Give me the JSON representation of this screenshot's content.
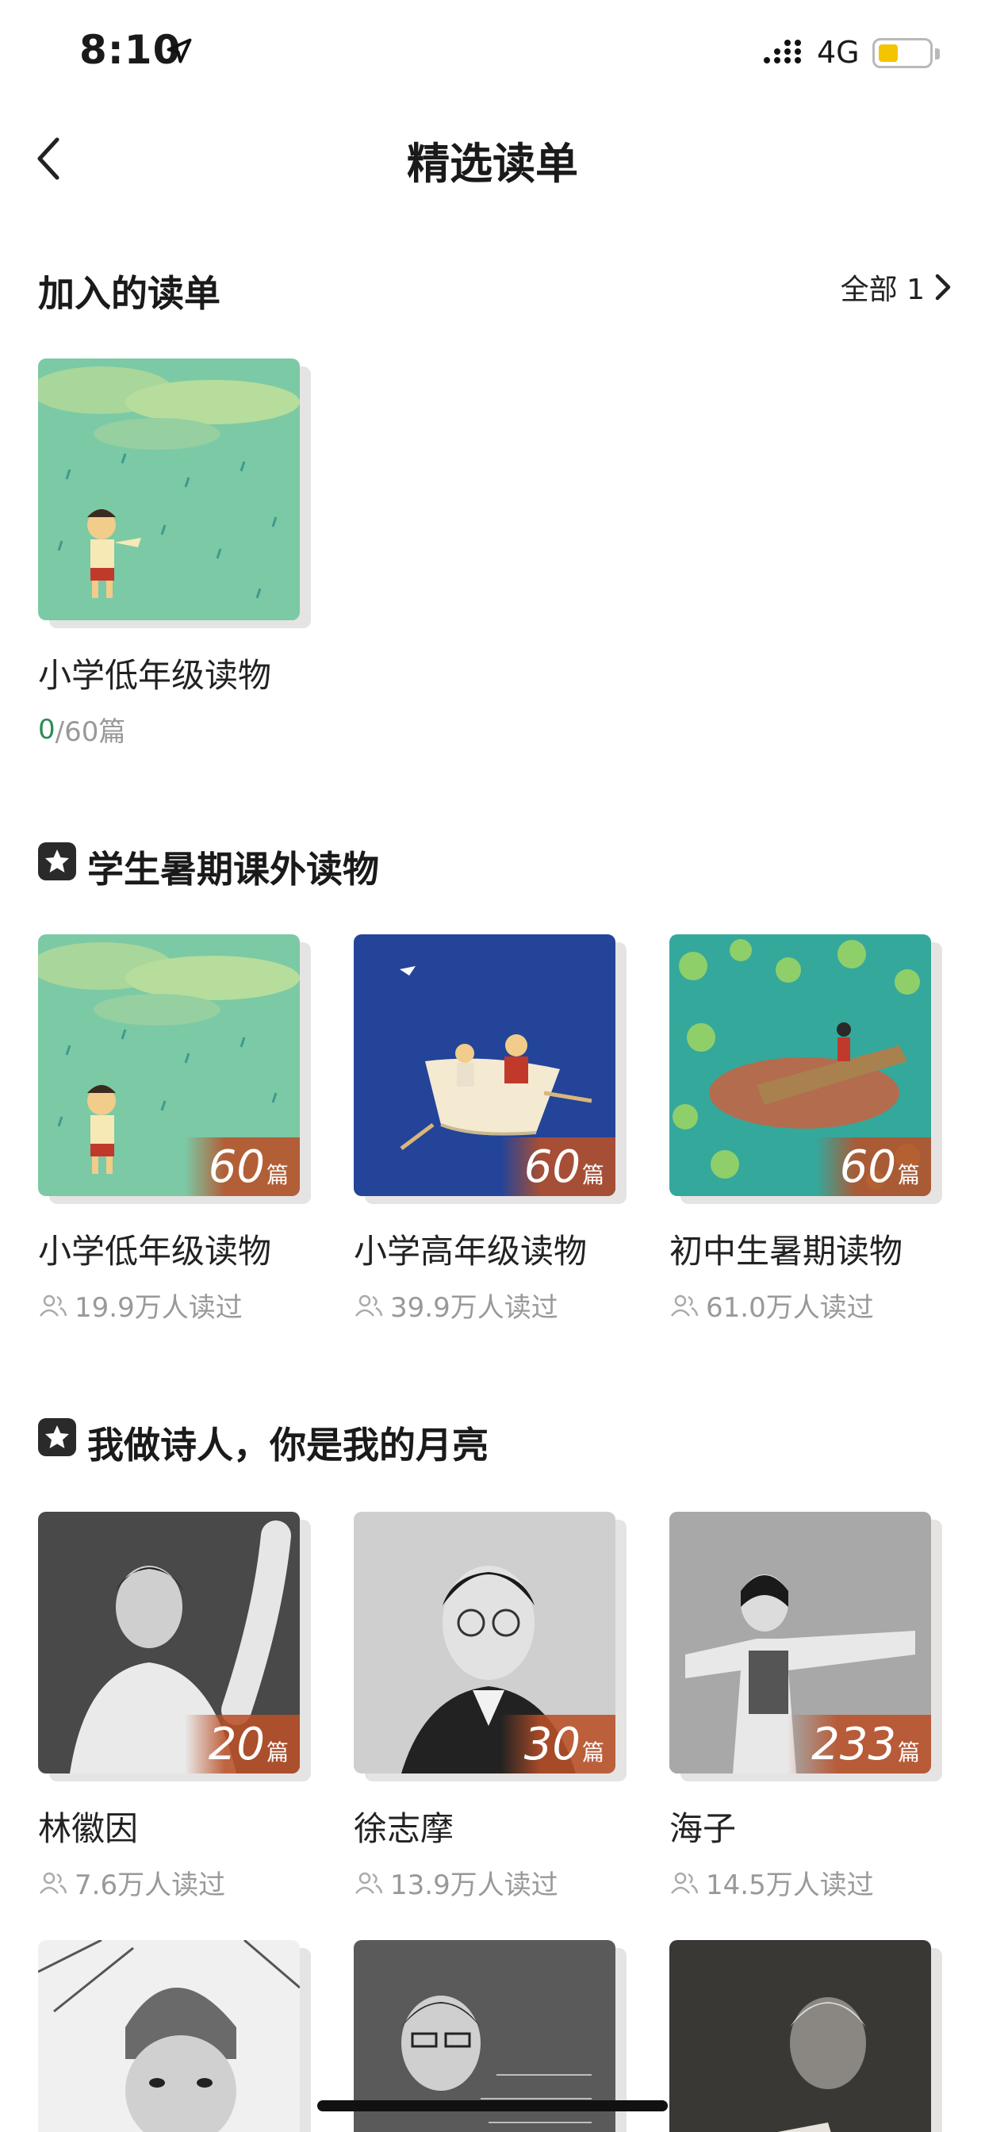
{
  "status": {
    "time": "8:10",
    "network": "4G",
    "battery_color": "#f5c400"
  },
  "nav": {
    "title": "精选读单"
  },
  "joined": {
    "title": "加入的读单",
    "see_all_label": "全部 1",
    "items": [
      {
        "title": "小学低年级读物",
        "progress_done": "0",
        "progress_total": "/60篇"
      }
    ]
  },
  "sections": [
    {
      "title": "学生暑期课外读物",
      "items": [
        {
          "title": "小学低年级读物",
          "count": "60",
          "unit": "篇",
          "readers": "19.9万人读过"
        },
        {
          "title": "小学高年级读物",
          "count": "60",
          "unit": "篇",
          "readers": "39.9万人读过"
        },
        {
          "title": "初中生暑期读物",
          "count": "60",
          "unit": "篇",
          "readers": "61.0万人读过"
        }
      ]
    },
    {
      "title": "我做诗人，你是我的月亮",
      "items": [
        {
          "title": "林徽因",
          "count": "20",
          "unit": "篇",
          "readers": "7.6万人读过"
        },
        {
          "title": "徐志摩",
          "count": "30",
          "unit": "篇",
          "readers": "13.9万人读过"
        },
        {
          "title": "海子",
          "count": "233",
          "unit": "篇",
          "readers": "14.5万人读过"
        }
      ]
    }
  ],
  "icons": {
    "back": "chevron-left-icon",
    "see_all": "chevron-right-icon",
    "section": "star-badge-icon",
    "readers": "readers-icon"
  },
  "colors": {
    "accent_green": "#2e8b57",
    "badge": "#b95028",
    "muted": "#999999"
  }
}
